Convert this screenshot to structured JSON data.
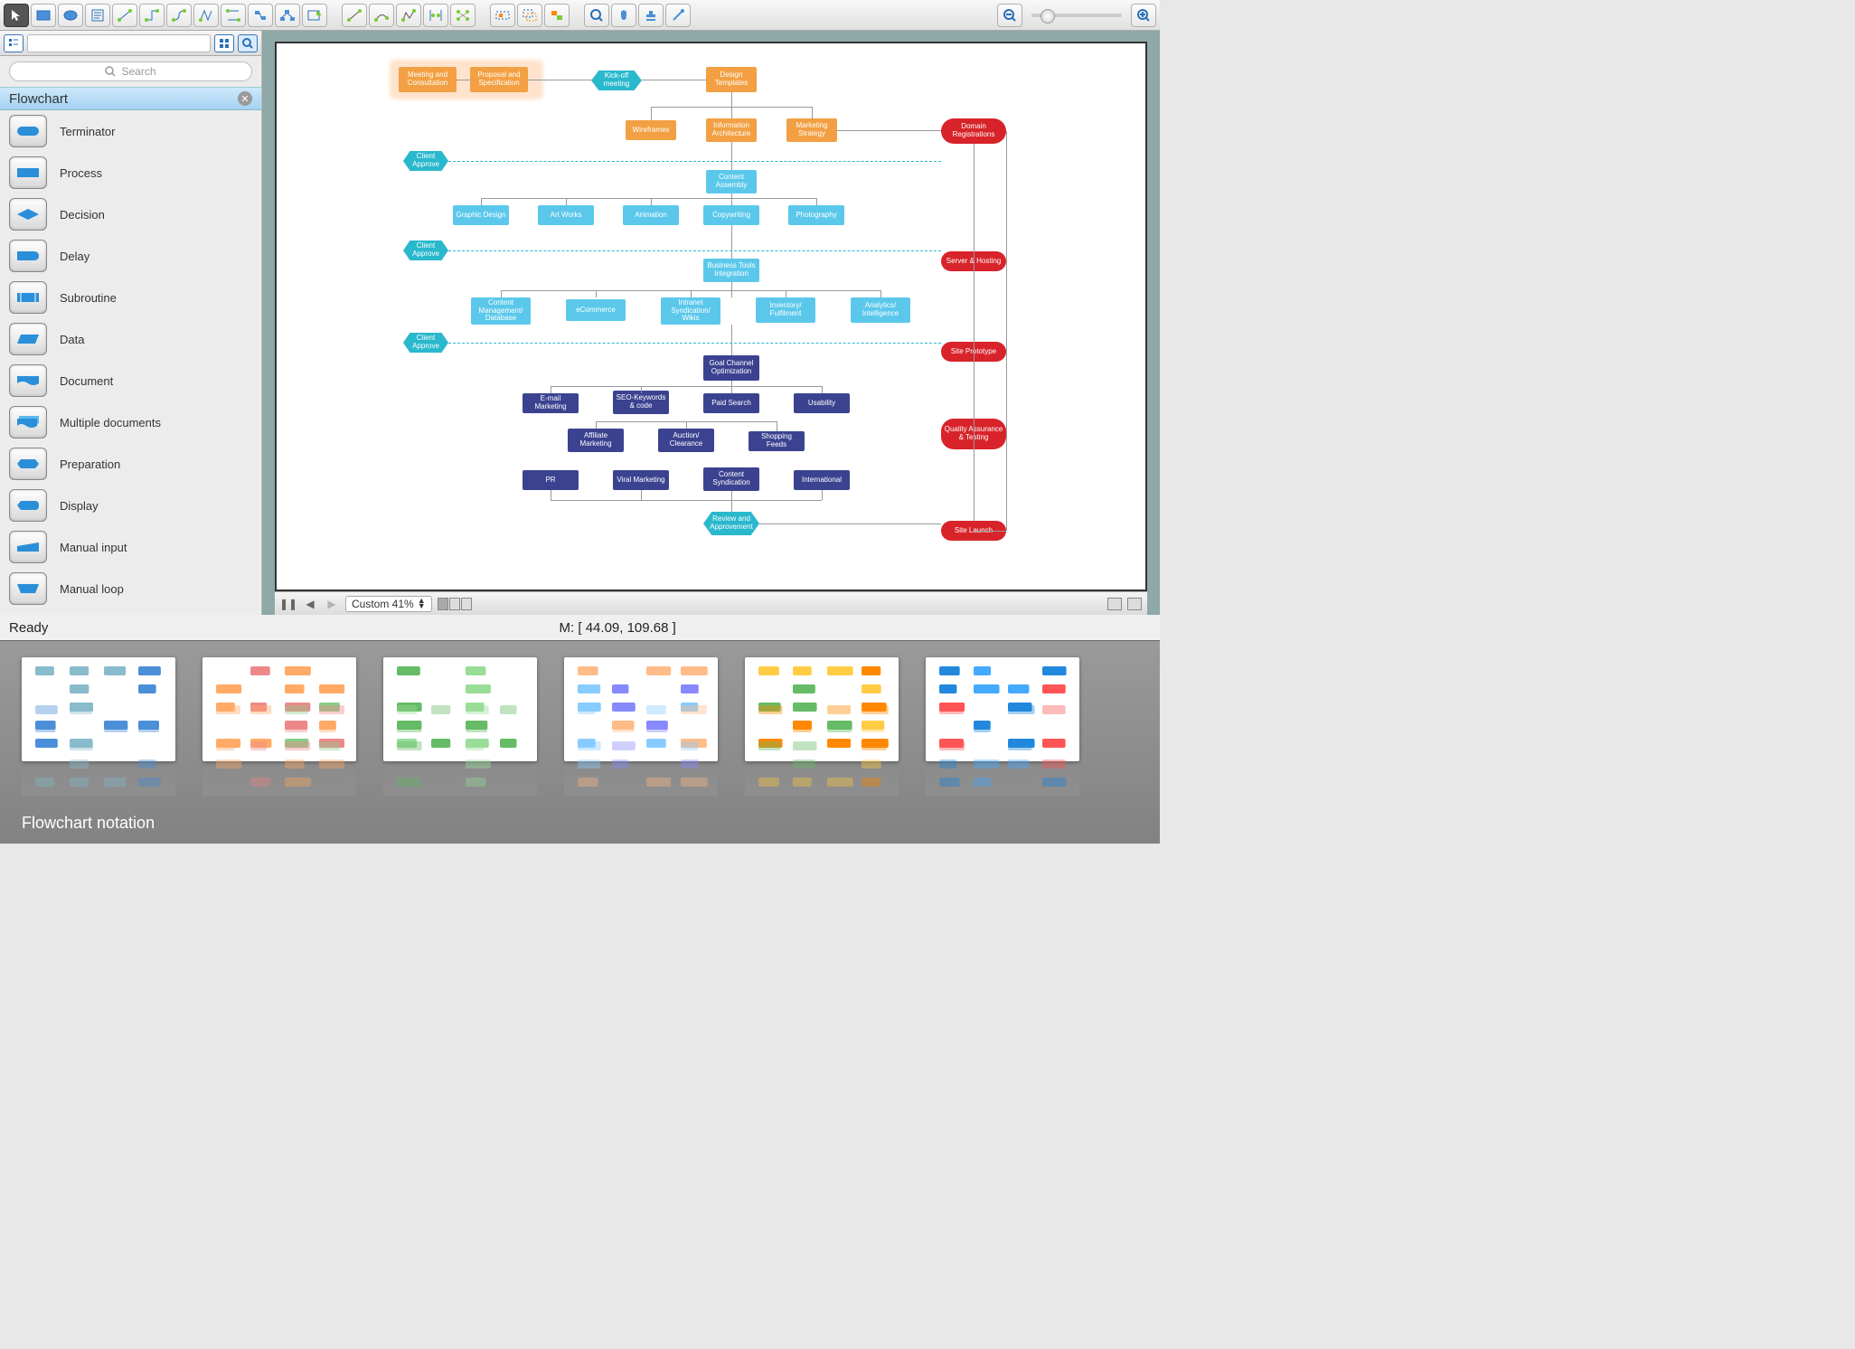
{
  "toolbar": {},
  "search": {
    "placeholder": "Search"
  },
  "sidebar": {
    "title": "Flowchart",
    "items": [
      {
        "label": "Terminator",
        "shape": "terminator"
      },
      {
        "label": "Process",
        "shape": "process"
      },
      {
        "label": "Decision",
        "shape": "decision"
      },
      {
        "label": "Delay",
        "shape": "delay"
      },
      {
        "label": "Subroutine",
        "shape": "subroutine"
      },
      {
        "label": "Data",
        "shape": "data"
      },
      {
        "label": "Document",
        "shape": "document"
      },
      {
        "label": "Multiple documents",
        "shape": "multidoc"
      },
      {
        "label": "Preparation",
        "shape": "preparation"
      },
      {
        "label": "Display",
        "shape": "display"
      },
      {
        "label": "Manual input",
        "shape": "manualinput"
      },
      {
        "label": "Manual loop",
        "shape": "manualloop"
      }
    ]
  },
  "canvas": {
    "zoom_label": "Custom 41%",
    "nodes": {
      "meeting": "Meeting and Consultation",
      "proposal": "Proposal and Specification",
      "kickoff": "Kick-off meeting",
      "design_templates": "Design Templates",
      "wireframes": "Wireframes",
      "info_arch": "Information Architecture",
      "marketing": "Marketing Strategy",
      "approve": "Client Approve",
      "content_assembly": "Content Assembly",
      "graphic": "Graphic Design",
      "artworks": "Art Works",
      "animation": "Animation",
      "copywriting": "Copywriting",
      "photography": "Photography",
      "biz_tools": "Business Tools Integration",
      "cms": "Content Management/ Database",
      "ecommerce": "eCommerce",
      "intranet": "Intranet Syndication/ Wikis",
      "inventory": "Inventory/ Fulfilment",
      "analytics": "Analytics/ Intelligence",
      "goal": "Goal Channel Optimization",
      "email": "E-mail Marketing",
      "seo": "SEO-Keywords & code",
      "paid": "Paid Search",
      "usability": "Usability",
      "affiliate": "Affiliate Marketing",
      "auction": "Auction/ Clearance",
      "shopping": "Shopping Feeds",
      "pr": "PR",
      "viral": "Viral Marketing",
      "content_synd": "Content Syndication",
      "international": "International",
      "review": "Review and Approvement",
      "domain": "Domain Registrations",
      "server": "Server & Hosting",
      "prototype": "Site Prototype",
      "qa": "Quality Assurance & Testing",
      "launch": "Site Launch"
    }
  },
  "status": {
    "ready": "Ready",
    "coords": "M: [ 44.09, 109.68 ]"
  },
  "gallery": {
    "caption": "Flowchart notation"
  }
}
